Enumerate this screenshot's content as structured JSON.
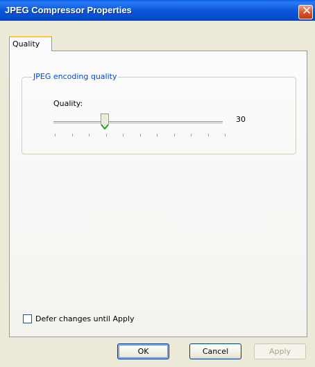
{
  "window": {
    "title": "JPEG Compressor Properties"
  },
  "tabs": [
    {
      "label": "Quality",
      "active": true
    }
  ],
  "group": {
    "label": "JPEG encoding quality",
    "quality_label": "Quality:",
    "slider_value": 30,
    "value_text": "30"
  },
  "defer_checkbox": {
    "label": "Defer changes until Apply",
    "checked": false
  },
  "buttons": {
    "ok": "OK",
    "cancel": "Cancel",
    "apply": "Apply"
  },
  "colors": {
    "title_bar": "#0d5bdc",
    "group_label": "#0046d5",
    "tab_highlight": "#ffc83c",
    "close_button": "#d9502d"
  }
}
